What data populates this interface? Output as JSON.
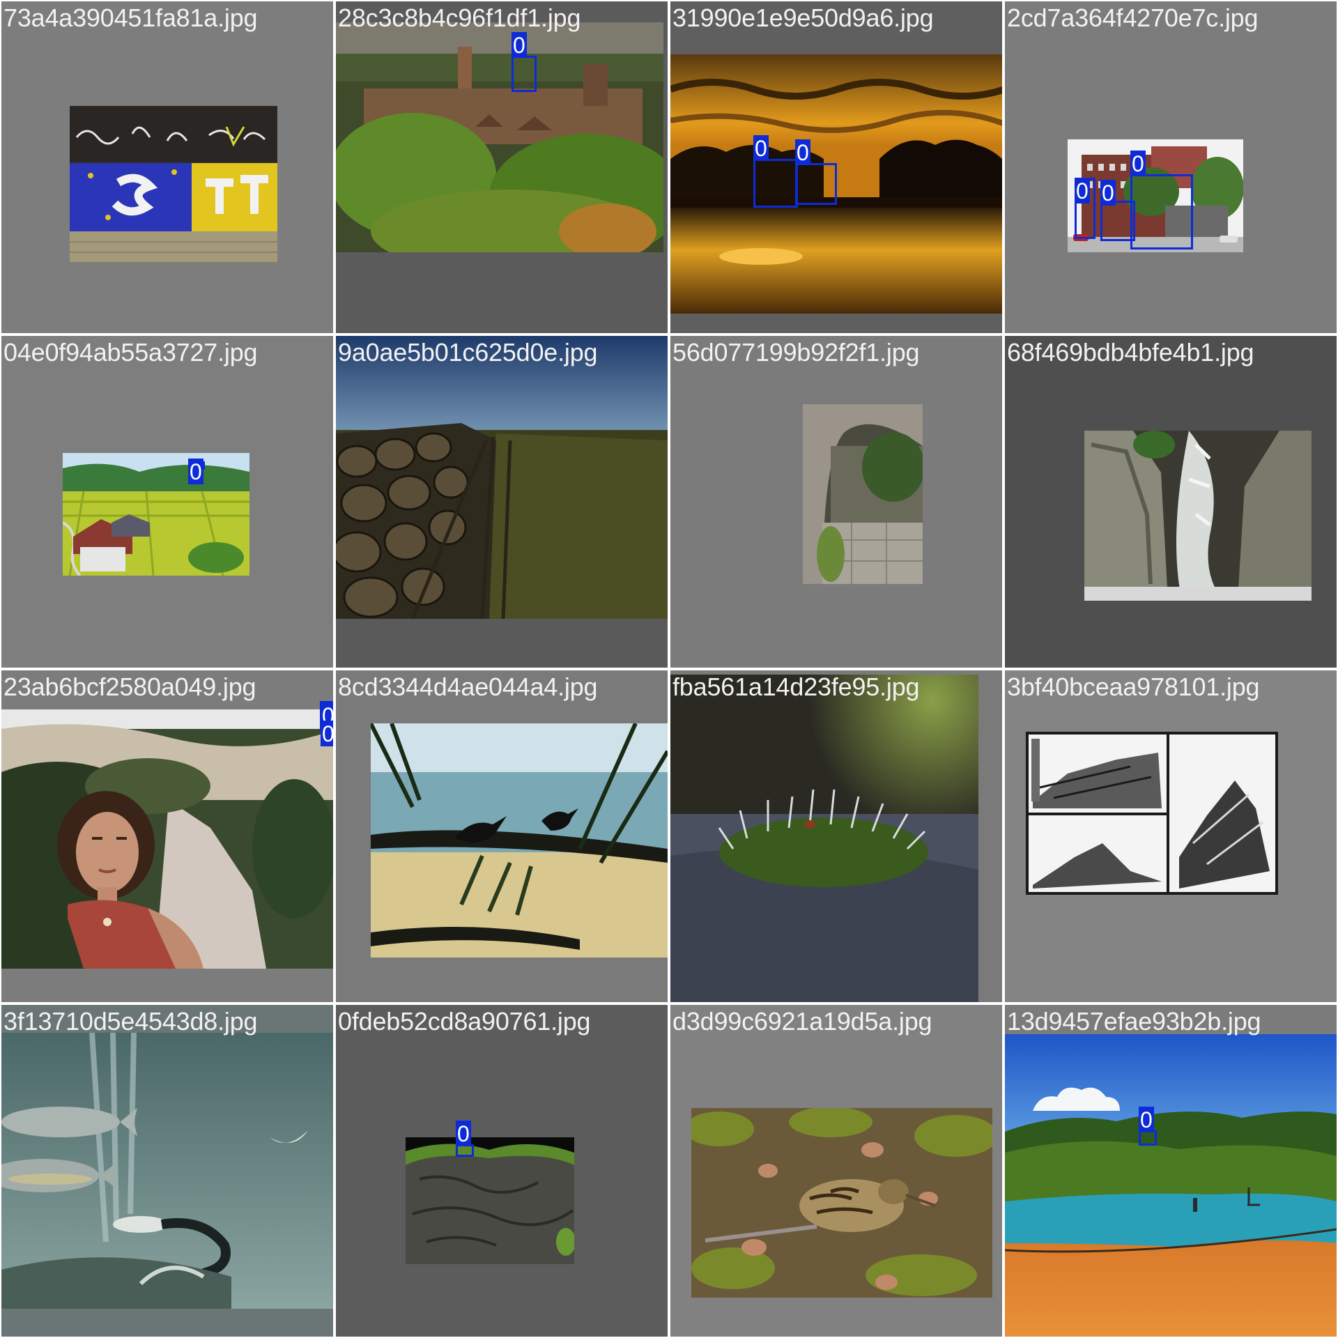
{
  "mosaic": {
    "tiles": [
      {
        "filename": "73a4a390451fa81a.jpg",
        "background": "#7d7d7d",
        "scene": "graffiti-wall",
        "detections": []
      },
      {
        "filename": "28c3c8b4c96f1df1.jpg",
        "background": "#5b5b5b",
        "scene": "town-hillside",
        "detections": [
          {
            "label": "0"
          }
        ]
      },
      {
        "filename": "31990e1e9e50d9a6.jpg",
        "background": "#5f5f5f",
        "scene": "sunset-lake",
        "detections": [
          {
            "label": "0"
          },
          {
            "label": "0"
          }
        ]
      },
      {
        "filename": "2cd7a364f4270e7c.jpg",
        "background": "#7c7c7c",
        "scene": "street-buildings",
        "detections": [
          {
            "label": "0"
          },
          {
            "label": "0"
          },
          {
            "label": "0"
          }
        ]
      },
      {
        "filename": "04e0f94ab55a3727.jpg",
        "background": "#7e7e7e",
        "scene": "rice-valley",
        "detections": [
          {
            "label": "0"
          }
        ]
      },
      {
        "filename": "9a0ae5b01c625d0e.jpg",
        "background": "#5a5a5a",
        "scene": "stone-wall-fence",
        "detections": []
      },
      {
        "filename": "56d077199b92f2f1.jpg",
        "background": "#7b7b7b",
        "scene": "ruined-archway",
        "detections": []
      },
      {
        "filename": "68f469bdb4bfe4b1.jpg",
        "background": "#4f4f4f",
        "scene": "rock-waterfall",
        "detections": []
      },
      {
        "filename": "23ab6bcf2580a049.jpg",
        "background": "#7c7c7c",
        "scene": "woman-mountains",
        "detections": [
          {
            "label": "0"
          },
          {
            "label": "0"
          }
        ]
      },
      {
        "filename": "8cd3344d4ae044a4.jpg",
        "background": "#7a7a7a",
        "scene": "birds-on-branch",
        "detections": []
      },
      {
        "filename": "fba561a14d23fe95.jpg",
        "background": "#7a7a7a",
        "scene": "moss-closeup",
        "detections": []
      },
      {
        "filename": "3bf40bceaa978101.jpg",
        "background": "#848484",
        "scene": "collapsed-barn-collage",
        "detections": []
      },
      {
        "filename": "3f13710d5e4543d8.jpg",
        "background": "#6a7575",
        "scene": "underwater-diver",
        "detections": []
      },
      {
        "filename": "0fdeb52cd8a90761.jpg",
        "background": "#5c5c5c",
        "scene": "rock-cave",
        "detections": [
          {
            "label": "0"
          }
        ]
      },
      {
        "filename": "d3d99c6921a19d5a.jpg",
        "background": "#818181",
        "scene": "snipe-bird",
        "detections": []
      },
      {
        "filename": "13d9457efae93b2b.jpg",
        "background": "#7b7b7b",
        "scene": "beach-cove",
        "detections": [
          {
            "label": "0"
          }
        ]
      }
    ]
  },
  "colors": {
    "box_border": "#0d2bd6",
    "box_tag_bg": "#0d2bd6",
    "box_tag_text": "#ffffff",
    "filename_text": "#f2f2f2",
    "grid_gap": "#ffffff"
  }
}
